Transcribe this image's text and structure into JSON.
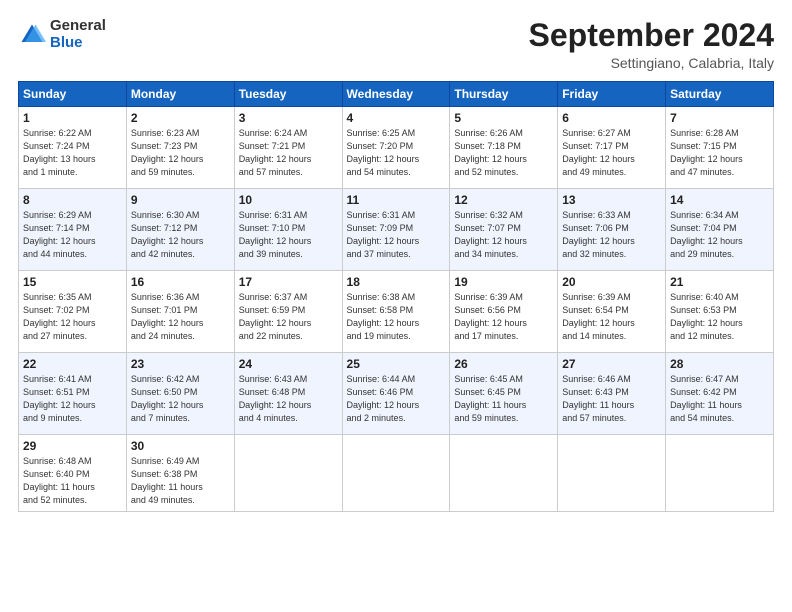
{
  "logo": {
    "general": "General",
    "blue": "Blue"
  },
  "title": {
    "month_year": "September 2024",
    "location": "Settingiano, Calabria, Italy"
  },
  "headers": [
    "Sunday",
    "Monday",
    "Tuesday",
    "Wednesday",
    "Thursday",
    "Friday",
    "Saturday"
  ],
  "weeks": [
    [
      {
        "day": "1",
        "info": "Sunrise: 6:22 AM\nSunset: 7:24 PM\nDaylight: 13 hours\nand 1 minute."
      },
      {
        "day": "2",
        "info": "Sunrise: 6:23 AM\nSunset: 7:23 PM\nDaylight: 12 hours\nand 59 minutes."
      },
      {
        "day": "3",
        "info": "Sunrise: 6:24 AM\nSunset: 7:21 PM\nDaylight: 12 hours\nand 57 minutes."
      },
      {
        "day": "4",
        "info": "Sunrise: 6:25 AM\nSunset: 7:20 PM\nDaylight: 12 hours\nand 54 minutes."
      },
      {
        "day": "5",
        "info": "Sunrise: 6:26 AM\nSunset: 7:18 PM\nDaylight: 12 hours\nand 52 minutes."
      },
      {
        "day": "6",
        "info": "Sunrise: 6:27 AM\nSunset: 7:17 PM\nDaylight: 12 hours\nand 49 minutes."
      },
      {
        "day": "7",
        "info": "Sunrise: 6:28 AM\nSunset: 7:15 PM\nDaylight: 12 hours\nand 47 minutes."
      }
    ],
    [
      {
        "day": "8",
        "info": "Sunrise: 6:29 AM\nSunset: 7:14 PM\nDaylight: 12 hours\nand 44 minutes."
      },
      {
        "day": "9",
        "info": "Sunrise: 6:30 AM\nSunset: 7:12 PM\nDaylight: 12 hours\nand 42 minutes."
      },
      {
        "day": "10",
        "info": "Sunrise: 6:31 AM\nSunset: 7:10 PM\nDaylight: 12 hours\nand 39 minutes."
      },
      {
        "day": "11",
        "info": "Sunrise: 6:31 AM\nSunset: 7:09 PM\nDaylight: 12 hours\nand 37 minutes."
      },
      {
        "day": "12",
        "info": "Sunrise: 6:32 AM\nSunset: 7:07 PM\nDaylight: 12 hours\nand 34 minutes."
      },
      {
        "day": "13",
        "info": "Sunrise: 6:33 AM\nSunset: 7:06 PM\nDaylight: 12 hours\nand 32 minutes."
      },
      {
        "day": "14",
        "info": "Sunrise: 6:34 AM\nSunset: 7:04 PM\nDaylight: 12 hours\nand 29 minutes."
      }
    ],
    [
      {
        "day": "15",
        "info": "Sunrise: 6:35 AM\nSunset: 7:02 PM\nDaylight: 12 hours\nand 27 minutes."
      },
      {
        "day": "16",
        "info": "Sunrise: 6:36 AM\nSunset: 7:01 PM\nDaylight: 12 hours\nand 24 minutes."
      },
      {
        "day": "17",
        "info": "Sunrise: 6:37 AM\nSunset: 6:59 PM\nDaylight: 12 hours\nand 22 minutes."
      },
      {
        "day": "18",
        "info": "Sunrise: 6:38 AM\nSunset: 6:58 PM\nDaylight: 12 hours\nand 19 minutes."
      },
      {
        "day": "19",
        "info": "Sunrise: 6:39 AM\nSunset: 6:56 PM\nDaylight: 12 hours\nand 17 minutes."
      },
      {
        "day": "20",
        "info": "Sunrise: 6:39 AM\nSunset: 6:54 PM\nDaylight: 12 hours\nand 14 minutes."
      },
      {
        "day": "21",
        "info": "Sunrise: 6:40 AM\nSunset: 6:53 PM\nDaylight: 12 hours\nand 12 minutes."
      }
    ],
    [
      {
        "day": "22",
        "info": "Sunrise: 6:41 AM\nSunset: 6:51 PM\nDaylight: 12 hours\nand 9 minutes."
      },
      {
        "day": "23",
        "info": "Sunrise: 6:42 AM\nSunset: 6:50 PM\nDaylight: 12 hours\nand 7 minutes."
      },
      {
        "day": "24",
        "info": "Sunrise: 6:43 AM\nSunset: 6:48 PM\nDaylight: 12 hours\nand 4 minutes."
      },
      {
        "day": "25",
        "info": "Sunrise: 6:44 AM\nSunset: 6:46 PM\nDaylight: 12 hours\nand 2 minutes."
      },
      {
        "day": "26",
        "info": "Sunrise: 6:45 AM\nSunset: 6:45 PM\nDaylight: 11 hours\nand 59 minutes."
      },
      {
        "day": "27",
        "info": "Sunrise: 6:46 AM\nSunset: 6:43 PM\nDaylight: 11 hours\nand 57 minutes."
      },
      {
        "day": "28",
        "info": "Sunrise: 6:47 AM\nSunset: 6:42 PM\nDaylight: 11 hours\nand 54 minutes."
      }
    ],
    [
      {
        "day": "29",
        "info": "Sunrise: 6:48 AM\nSunset: 6:40 PM\nDaylight: 11 hours\nand 52 minutes."
      },
      {
        "day": "30",
        "info": "Sunrise: 6:49 AM\nSunset: 6:38 PM\nDaylight: 11 hours\nand 49 minutes."
      },
      {
        "day": "",
        "info": ""
      },
      {
        "day": "",
        "info": ""
      },
      {
        "day": "",
        "info": ""
      },
      {
        "day": "",
        "info": ""
      },
      {
        "day": "",
        "info": ""
      }
    ]
  ]
}
